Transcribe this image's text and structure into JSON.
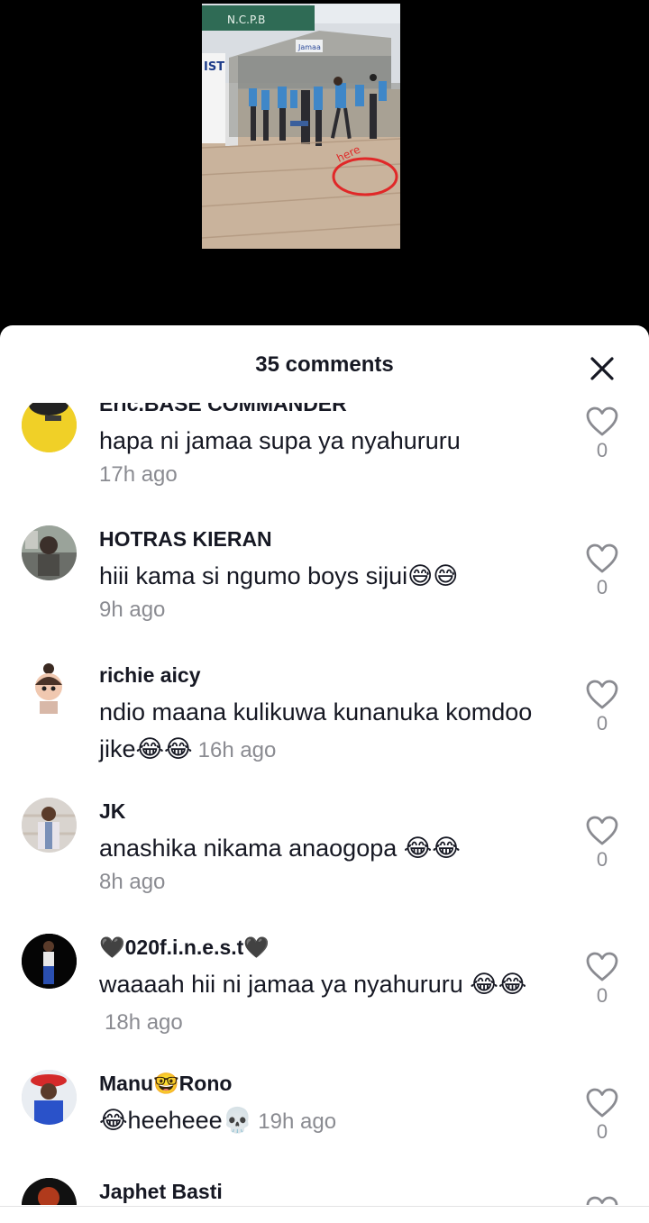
{
  "video": {
    "sign_text": "N.C.P.B",
    "shop_text": "Jamaa",
    "bus_text": "IST",
    "annotation": "here"
  },
  "sheet": {
    "title": "35 comments"
  },
  "comments": [
    {
      "username": "Eric.BASE COMMANDER",
      "text": "hapa ni jamaa supa ya nyahururu",
      "time": "17h ago",
      "likes": "0"
    },
    {
      "username": "HOTRAS KIERAN",
      "text": "hiii kama si ngumo boys sijui😅😅",
      "time": "9h ago",
      "likes": "0"
    },
    {
      "username": "richie aicy",
      "text": "ndio maana kulikuwa kunanuka komdoo jike😂😂",
      "time": "16h ago",
      "likes": "0"
    },
    {
      "username": "JK",
      "text": "anashika nikama anaogopa 😂😂",
      "time": "8h ago",
      "likes": "0"
    },
    {
      "username": "🖤020f.i.n.e.s.t🖤",
      "text": "waaaah hii ni jamaa ya nyahururu 😂😂",
      "time": "18h ago",
      "likes": "0"
    },
    {
      "username": "Manu🤓Rono",
      "text": "😂heeheee💀",
      "time": "19h ago",
      "likes": "0"
    },
    {
      "username": "Japhet Basti",
      "text": "",
      "time": "",
      "likes": ""
    }
  ],
  "colors": {
    "text_primary": "#161823",
    "text_secondary": "#8a8b91",
    "sheet_bg": "#ffffff",
    "video_bg": "#000000"
  },
  "icons": {
    "close": "close-icon",
    "like": "heart-outline-icon"
  }
}
